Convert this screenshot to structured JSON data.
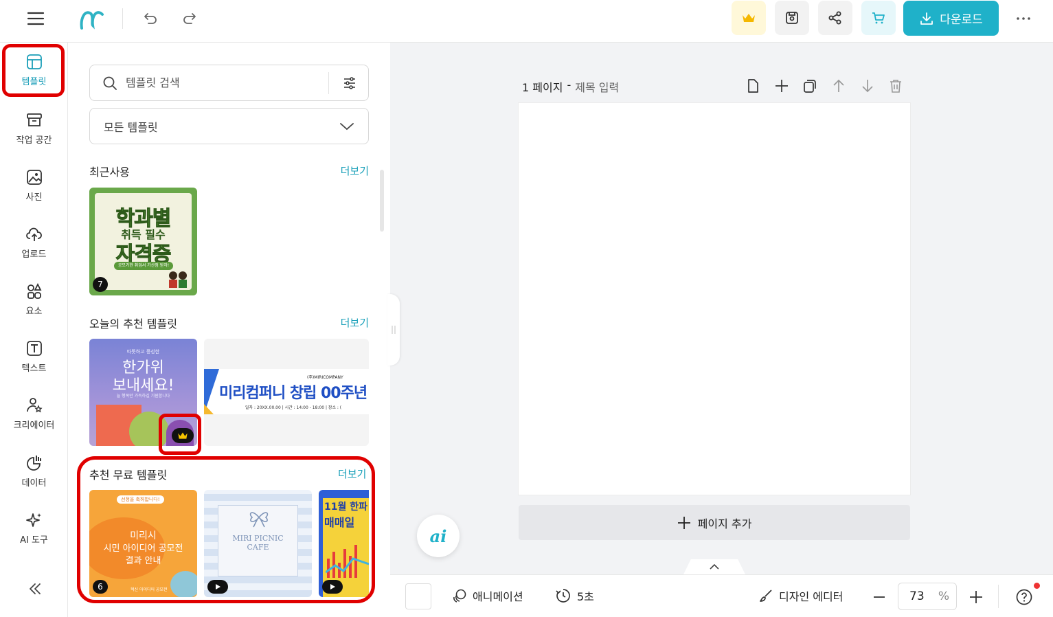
{
  "topbar": {
    "download_label": "다운로드"
  },
  "leftnav": {
    "items": [
      {
        "label": "템플릿",
        "icon": "template-icon"
      },
      {
        "label": "작업 공간",
        "icon": "archive-icon"
      },
      {
        "label": "사진",
        "icon": "image-icon"
      },
      {
        "label": "업로드",
        "icon": "cloud-upload-icon"
      },
      {
        "label": "요소",
        "icon": "shapes-icon"
      },
      {
        "label": "텍스트",
        "icon": "text-icon"
      },
      {
        "label": "크리에이터",
        "icon": "creator-icon"
      },
      {
        "label": "데이터",
        "icon": "chart-icon"
      },
      {
        "label": "AI 도구",
        "icon": "sparkle-icon"
      }
    ]
  },
  "panel": {
    "search_placeholder": "템플릿 검색",
    "category_select": "모든 템플릿",
    "sections": [
      {
        "title": "최근사용",
        "more": "더보기"
      },
      {
        "title": "오늘의 추천 템플릿",
        "more": "더보기"
      },
      {
        "title": "추천 무료 템플릿",
        "more": "더보기"
      }
    ],
    "recent": {
      "line1": "학과별",
      "line2": "취득 필수",
      "line3": "자격증",
      "pill": "공모가한 취업서 가산점 받자!",
      "badge": "7"
    },
    "featured1": {
      "small": "따뜻하고 풍성한",
      "line1": "한가위",
      "line2": "보내세요!",
      "sub": "늘 행복만 가득하길 기원합니다"
    },
    "featured2": {
      "company": "(주)MIRICOMPANY",
      "title": "미리컴퍼니 창립 00주년",
      "info": "일자 : 20XX.00.00 | 시간 : 14:00 - 18:00 | 장소 : ("
    },
    "free1": {
      "pill": "선정을 축하합니다!",
      "line1": "미리시",
      "line2": "시민 아이디어 공모전",
      "line3": "결과 안내",
      "footer": "혁신 아이디어 공모전",
      "badge": "6"
    },
    "free2": {
      "line1": "MIRI PICNIC",
      "line2": "CAFE"
    },
    "free3": {
      "line1": "11월 한파",
      "line2": "매매일"
    }
  },
  "canvas": {
    "page_number": "1 페이지",
    "page_sep": "-",
    "page_title_placeholder": "제목 입력",
    "add_page": "페이지 추가",
    "ai_label": "ai"
  },
  "bottombar": {
    "animation": "애니메이션",
    "duration": "5초",
    "design_editor": "디자인 에디터",
    "zoom": "73",
    "zoom_unit": "%"
  },
  "colors": {
    "accent": "#1fb1c9",
    "highlight": "#e00000"
  }
}
